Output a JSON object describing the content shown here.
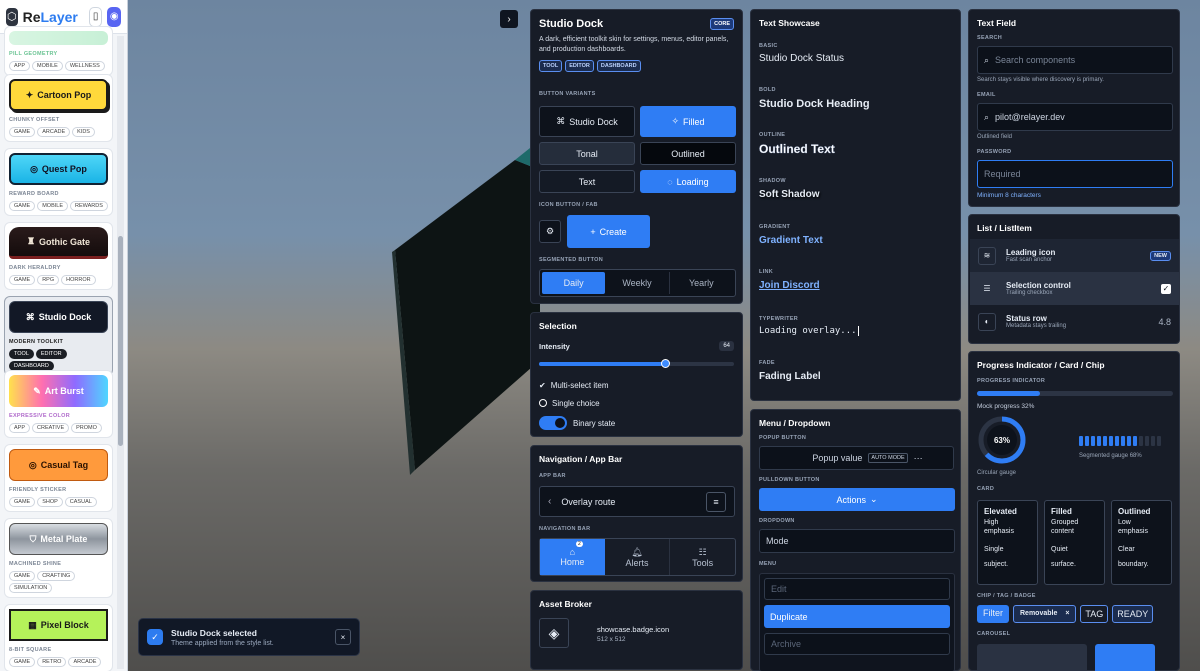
{
  "brand": {
    "name_a": "Re",
    "name_b": "Layer",
    "book_icon": "book-icon",
    "discord_icon": "discord-icon"
  },
  "sidebar": {
    "items": [
      {
        "name": "",
        "category": "PILL GEOMETRY",
        "tags": [
          "APP",
          "MOBILE",
          "WELLNESS"
        ]
      },
      {
        "name": "Cartoon Pop",
        "category": "CHUNKY OFFSET",
        "tags": [
          "GAME",
          "ARCADE",
          "KIDS"
        ]
      },
      {
        "name": "Quest Pop",
        "category": "REWARD BOARD",
        "tags": [
          "GAME",
          "MOBILE",
          "REWARDS"
        ]
      },
      {
        "name": "Gothic Gate",
        "category": "DARK HERALDRY",
        "tags": [
          "GAME",
          "RPG",
          "HORROR"
        ]
      },
      {
        "name": "Studio Dock",
        "category": "MODERN TOOLKIT",
        "tags": [
          "TOOL",
          "EDITOR",
          "DASHBOARD"
        ]
      },
      {
        "name": "Art Burst",
        "category": "EXPRESSIVE COLOR",
        "tags": [
          "APP",
          "CREATIVE",
          "PROMO"
        ]
      },
      {
        "name": "Casual Tag",
        "category": "FRIENDLY STICKER",
        "tags": [
          "GAME",
          "SHOP",
          "CASUAL"
        ]
      },
      {
        "name": "Metal Plate",
        "category": "MACHINED SHINE",
        "tags": [
          "GAME",
          "CRAFTING",
          "SIMULATION"
        ]
      },
      {
        "name": "Pixel Block",
        "category": "8-BIT SQUARE",
        "tags": [
          "GAME",
          "RETRO",
          "ARCADE"
        ]
      }
    ]
  },
  "toast": {
    "title": "Studio Dock selected",
    "subtitle": "Theme applied from the style list.",
    "close": "×"
  },
  "studio": {
    "title": "Studio Dock",
    "badge": "CORE",
    "desc": "A dark, efficient toolkit skin for settings, menus, editor panels, and production dashboards.",
    "tags": [
      "TOOL",
      "EDITOR",
      "DASHBOARD"
    ],
    "button_variants": "BUTTON VARIANTS",
    "btn_studio": "Studio Dock",
    "btn_filled": "Filled",
    "btn_tonal": "Tonal",
    "btn_outlined": "Outlined",
    "btn_text": "Text",
    "btn_loading": "Loading",
    "icon_fab": "ICON BUTTON / FAB",
    "fab_create": "Create",
    "segmented": "SEGMENTED BUTTON",
    "seg": [
      "Daily",
      "Weekly",
      "Yearly"
    ]
  },
  "selection": {
    "title": "Selection",
    "intensity": "Intensity",
    "value": "64",
    "slider": 0.64,
    "multi": "Multi-select item",
    "single": "Single choice",
    "binary": "Binary state"
  },
  "nav": {
    "title": "Navigation / App Bar",
    "app_bar": "APP BAR",
    "route": "Overlay route",
    "nav_bar": "NAVIGATION BAR",
    "home": "Home",
    "alerts": "Alerts",
    "tools": "Tools",
    "badge": "2"
  },
  "asset": {
    "title": "Asset Broker",
    "name": "showcase.badge.icon",
    "size": "512 x 512"
  },
  "text": {
    "title": "Text Showcase",
    "items": [
      {
        "label": "BASIC",
        "text": "Studio Dock Status"
      },
      {
        "label": "BOLD",
        "text": "Studio Dock Heading"
      },
      {
        "label": "OUTLINE",
        "text": "Outlined Text"
      },
      {
        "label": "SHADOW",
        "text": "Soft Shadow"
      },
      {
        "label": "GRADIENT",
        "text": "Gradient Text"
      },
      {
        "label": "LINK",
        "text": "Join Discord"
      },
      {
        "label": "TYPEWRITER",
        "text": "Loading overlay..."
      },
      {
        "label": "FADE",
        "text": "Fading Label"
      }
    ]
  },
  "menu": {
    "title": "Menu / Dropdown",
    "popup": "POPUP BUTTON",
    "popup_value": "Popup value",
    "auto": "AUTO MODE",
    "pulldown": "PULLDOWN BUTTON",
    "actions": "Actions",
    "dropdown": "DROPDOWN",
    "mode": "Mode",
    "menu": "MENU",
    "items": [
      "Edit",
      "Duplicate",
      "Archive"
    ]
  },
  "textfield": {
    "title": "Text Field",
    "search": "SEARCH",
    "search_ph": "Search components",
    "search_help": "Search stays visible where discovery is primary.",
    "email": "EMAIL",
    "email_val": "pilot@relayer.dev",
    "email_help": "Outlined field",
    "password": "PASSWORD",
    "password_ph": "Required",
    "password_help": "Minimum 8 characters"
  },
  "list": {
    "title": "List / ListItem",
    "items": [
      {
        "title": "Leading icon",
        "sub": "Fast scan anchor",
        "trail": "NEW"
      },
      {
        "title": "Selection control",
        "sub": "Trailing checkbox",
        "trail": "✓"
      },
      {
        "title": "Status row",
        "sub": "Metadata stays trailing",
        "trail": "4.8"
      }
    ]
  },
  "progress": {
    "title": "Progress Indicator / Card / Chip",
    "indicator": "PROGRESS INDICATOR",
    "mock": "Mock progress 32%",
    "mock_value": 0.32,
    "gauge": "63%",
    "gauge_value": 0.63,
    "circular": "Circular gauge",
    "segmented": "Segmented gauge 68%",
    "seg_value": 0.68,
    "card": "CARD",
    "cards": [
      {
        "title": "Elevated",
        "line1": "High",
        "line2": "emphasis",
        "line3": "Single",
        "line4": "subject."
      },
      {
        "title": "Filled",
        "line1": "Grouped",
        "line2": "content",
        "line3": "Quiet",
        "line4": "surface."
      },
      {
        "title": "Outlined",
        "line1": "Low",
        "line2": "emphasis",
        "line3": "Clear",
        "line4": "boundary."
      }
    ],
    "chip_label": "CHIP / TAG / BADGE",
    "chips": [
      "Filter",
      "Removable",
      "TAG",
      "READY"
    ],
    "carousel": "CAROUSEL"
  }
}
